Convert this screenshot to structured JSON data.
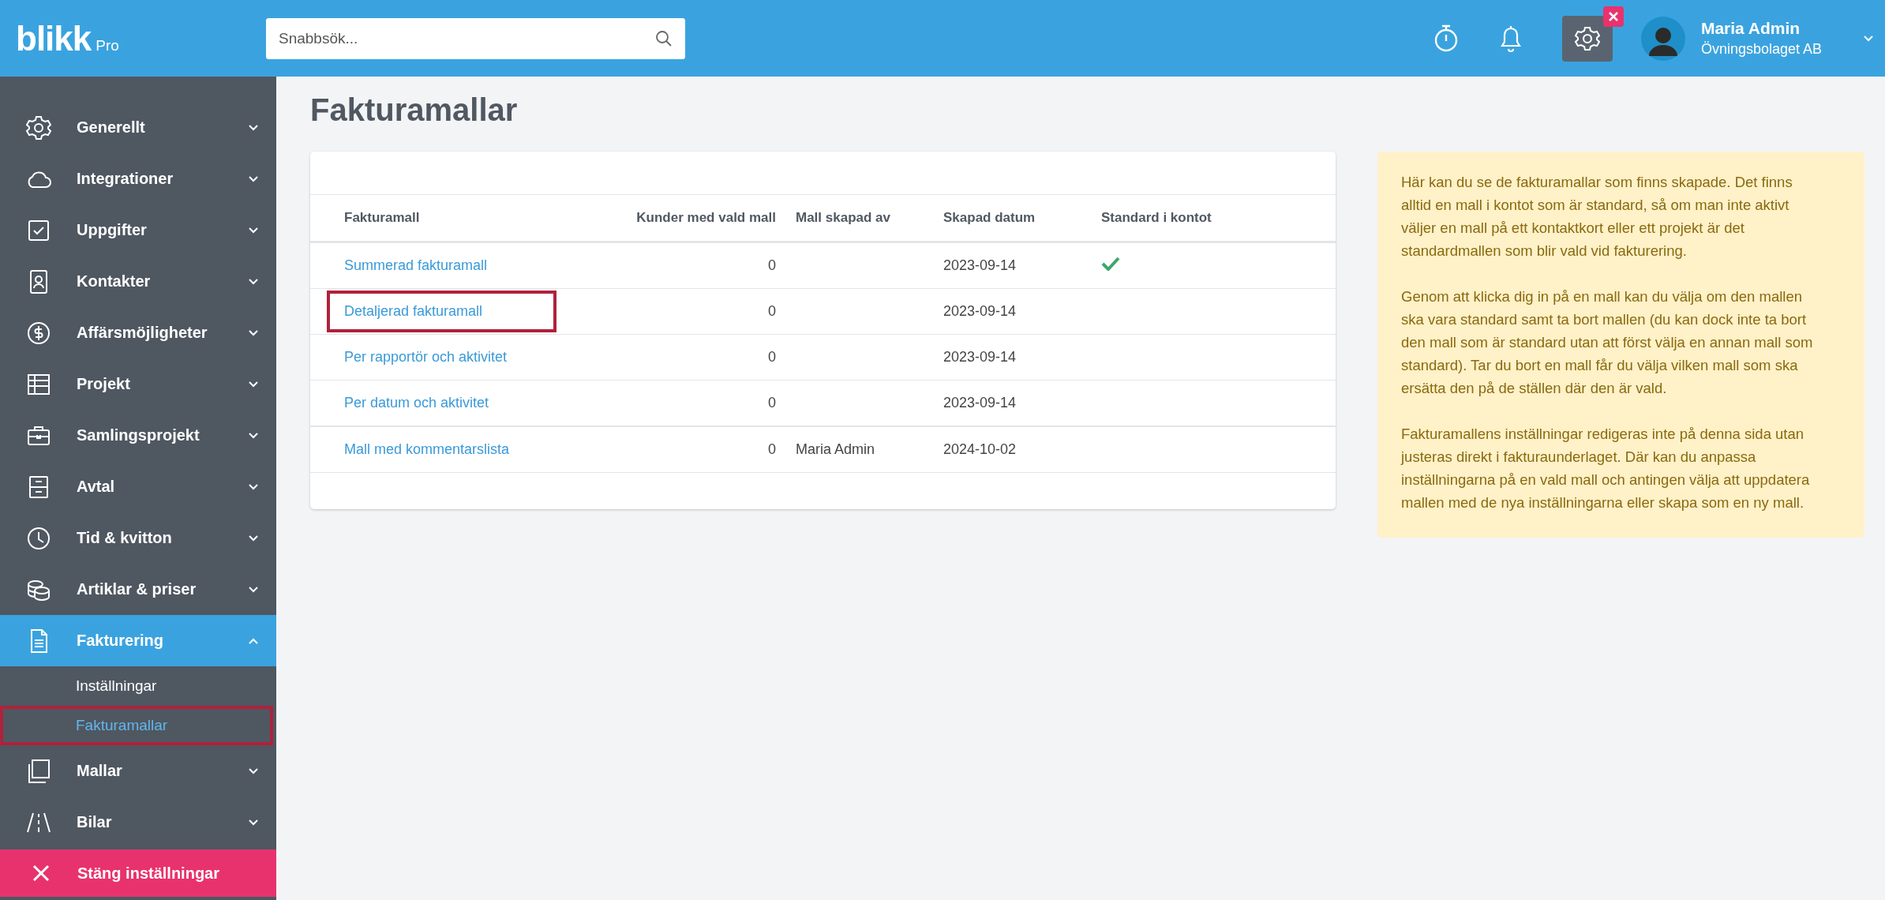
{
  "topbar": {
    "logo": "blikk",
    "logo_suffix": "Pro",
    "search": {
      "placeholder": "Snabbsök..."
    },
    "settings_active": true,
    "user": {
      "name": "Maria Admin",
      "company": "Övningsbolaget AB"
    }
  },
  "sidebar": {
    "items": [
      {
        "label": "Generellt",
        "expanded": false,
        "selected": false
      },
      {
        "label": "Integrationer",
        "expanded": false,
        "selected": false
      },
      {
        "label": "Uppgifter",
        "expanded": false,
        "selected": false
      },
      {
        "label": "Kontakter",
        "expanded": false,
        "selected": false
      },
      {
        "label": "Affärsmöjligheter",
        "expanded": false,
        "selected": false
      },
      {
        "label": "Projekt",
        "expanded": false,
        "selected": false
      },
      {
        "label": "Samlingsprojekt",
        "expanded": false,
        "selected": false
      },
      {
        "label": "Avtal",
        "expanded": false,
        "selected": false
      },
      {
        "label": "Tid & kvitton",
        "expanded": false,
        "selected": false
      },
      {
        "label": "Artiklar & priser",
        "expanded": false,
        "selected": false
      },
      {
        "label": "Fakturering",
        "expanded": true,
        "selected": true,
        "children": [
          {
            "label": "Inställningar",
            "selected": false,
            "highlighted": false
          },
          {
            "label": "Fakturamallar",
            "selected": true,
            "highlighted": true
          }
        ]
      },
      {
        "label": "Mallar",
        "expanded": false,
        "selected": false
      },
      {
        "label": "Bilar",
        "expanded": false,
        "selected": false
      }
    ],
    "close_button": {
      "label": "Stäng inställningar"
    }
  },
  "page": {
    "title": "Fakturamallar"
  },
  "table": {
    "columns": [
      "Fakturamall",
      "Kunder med vald mall",
      "Mall skapad av",
      "Skapad datum",
      "Standard i kontot"
    ],
    "rows": [
      {
        "name": "Summerad fakturamall",
        "customers": "0",
        "created_by": "",
        "created": "2023-09-14",
        "standard": true,
        "highlighted": false
      },
      {
        "name": "Detaljerad fakturamall",
        "customers": "0",
        "created_by": "",
        "created": "2023-09-14",
        "standard": false,
        "highlighted": true
      },
      {
        "name": "Per rapportör och aktivitet",
        "customers": "0",
        "created_by": "",
        "created": "2023-09-14",
        "standard": false,
        "highlighted": false
      },
      {
        "name": "Per datum och aktivitet",
        "customers": "0",
        "created_by": "",
        "created": "2023-09-14",
        "standard": false,
        "highlighted": false
      },
      {
        "name": "Mall med kommentarslista",
        "customers": "0",
        "created_by": "Maria Admin",
        "created": "2024-10-02",
        "standard": false,
        "highlighted": false
      }
    ]
  },
  "info": {
    "paragraphs": [
      "Här kan du se de fakturamallar som finns skapade. Det finns alltid en mall i kontot som är standard, så om man inte aktivt väljer en mall på ett kontaktkort eller ett projekt är det standardmallen som blir vald vid fakturering.",
      "Genom att klicka dig in på en mall kan du välja om den mallen ska vara standard samt ta bort mallen (du kan dock inte ta bort den mall som är standard utan att först välja en annan mall som standard). Tar du bort en mall får du välja vilken mall som ska ersätta den på de ställen där den är vald.",
      "Fakturamallens inställningar redigeras inte på denna sida utan justeras direkt i fakturaunderlaget. Där kan du anpassa inställningarna på en vald mall och antingen välja att uppdatera mallen med de nya inställningarna eller skapa som en ny mall."
    ]
  }
}
